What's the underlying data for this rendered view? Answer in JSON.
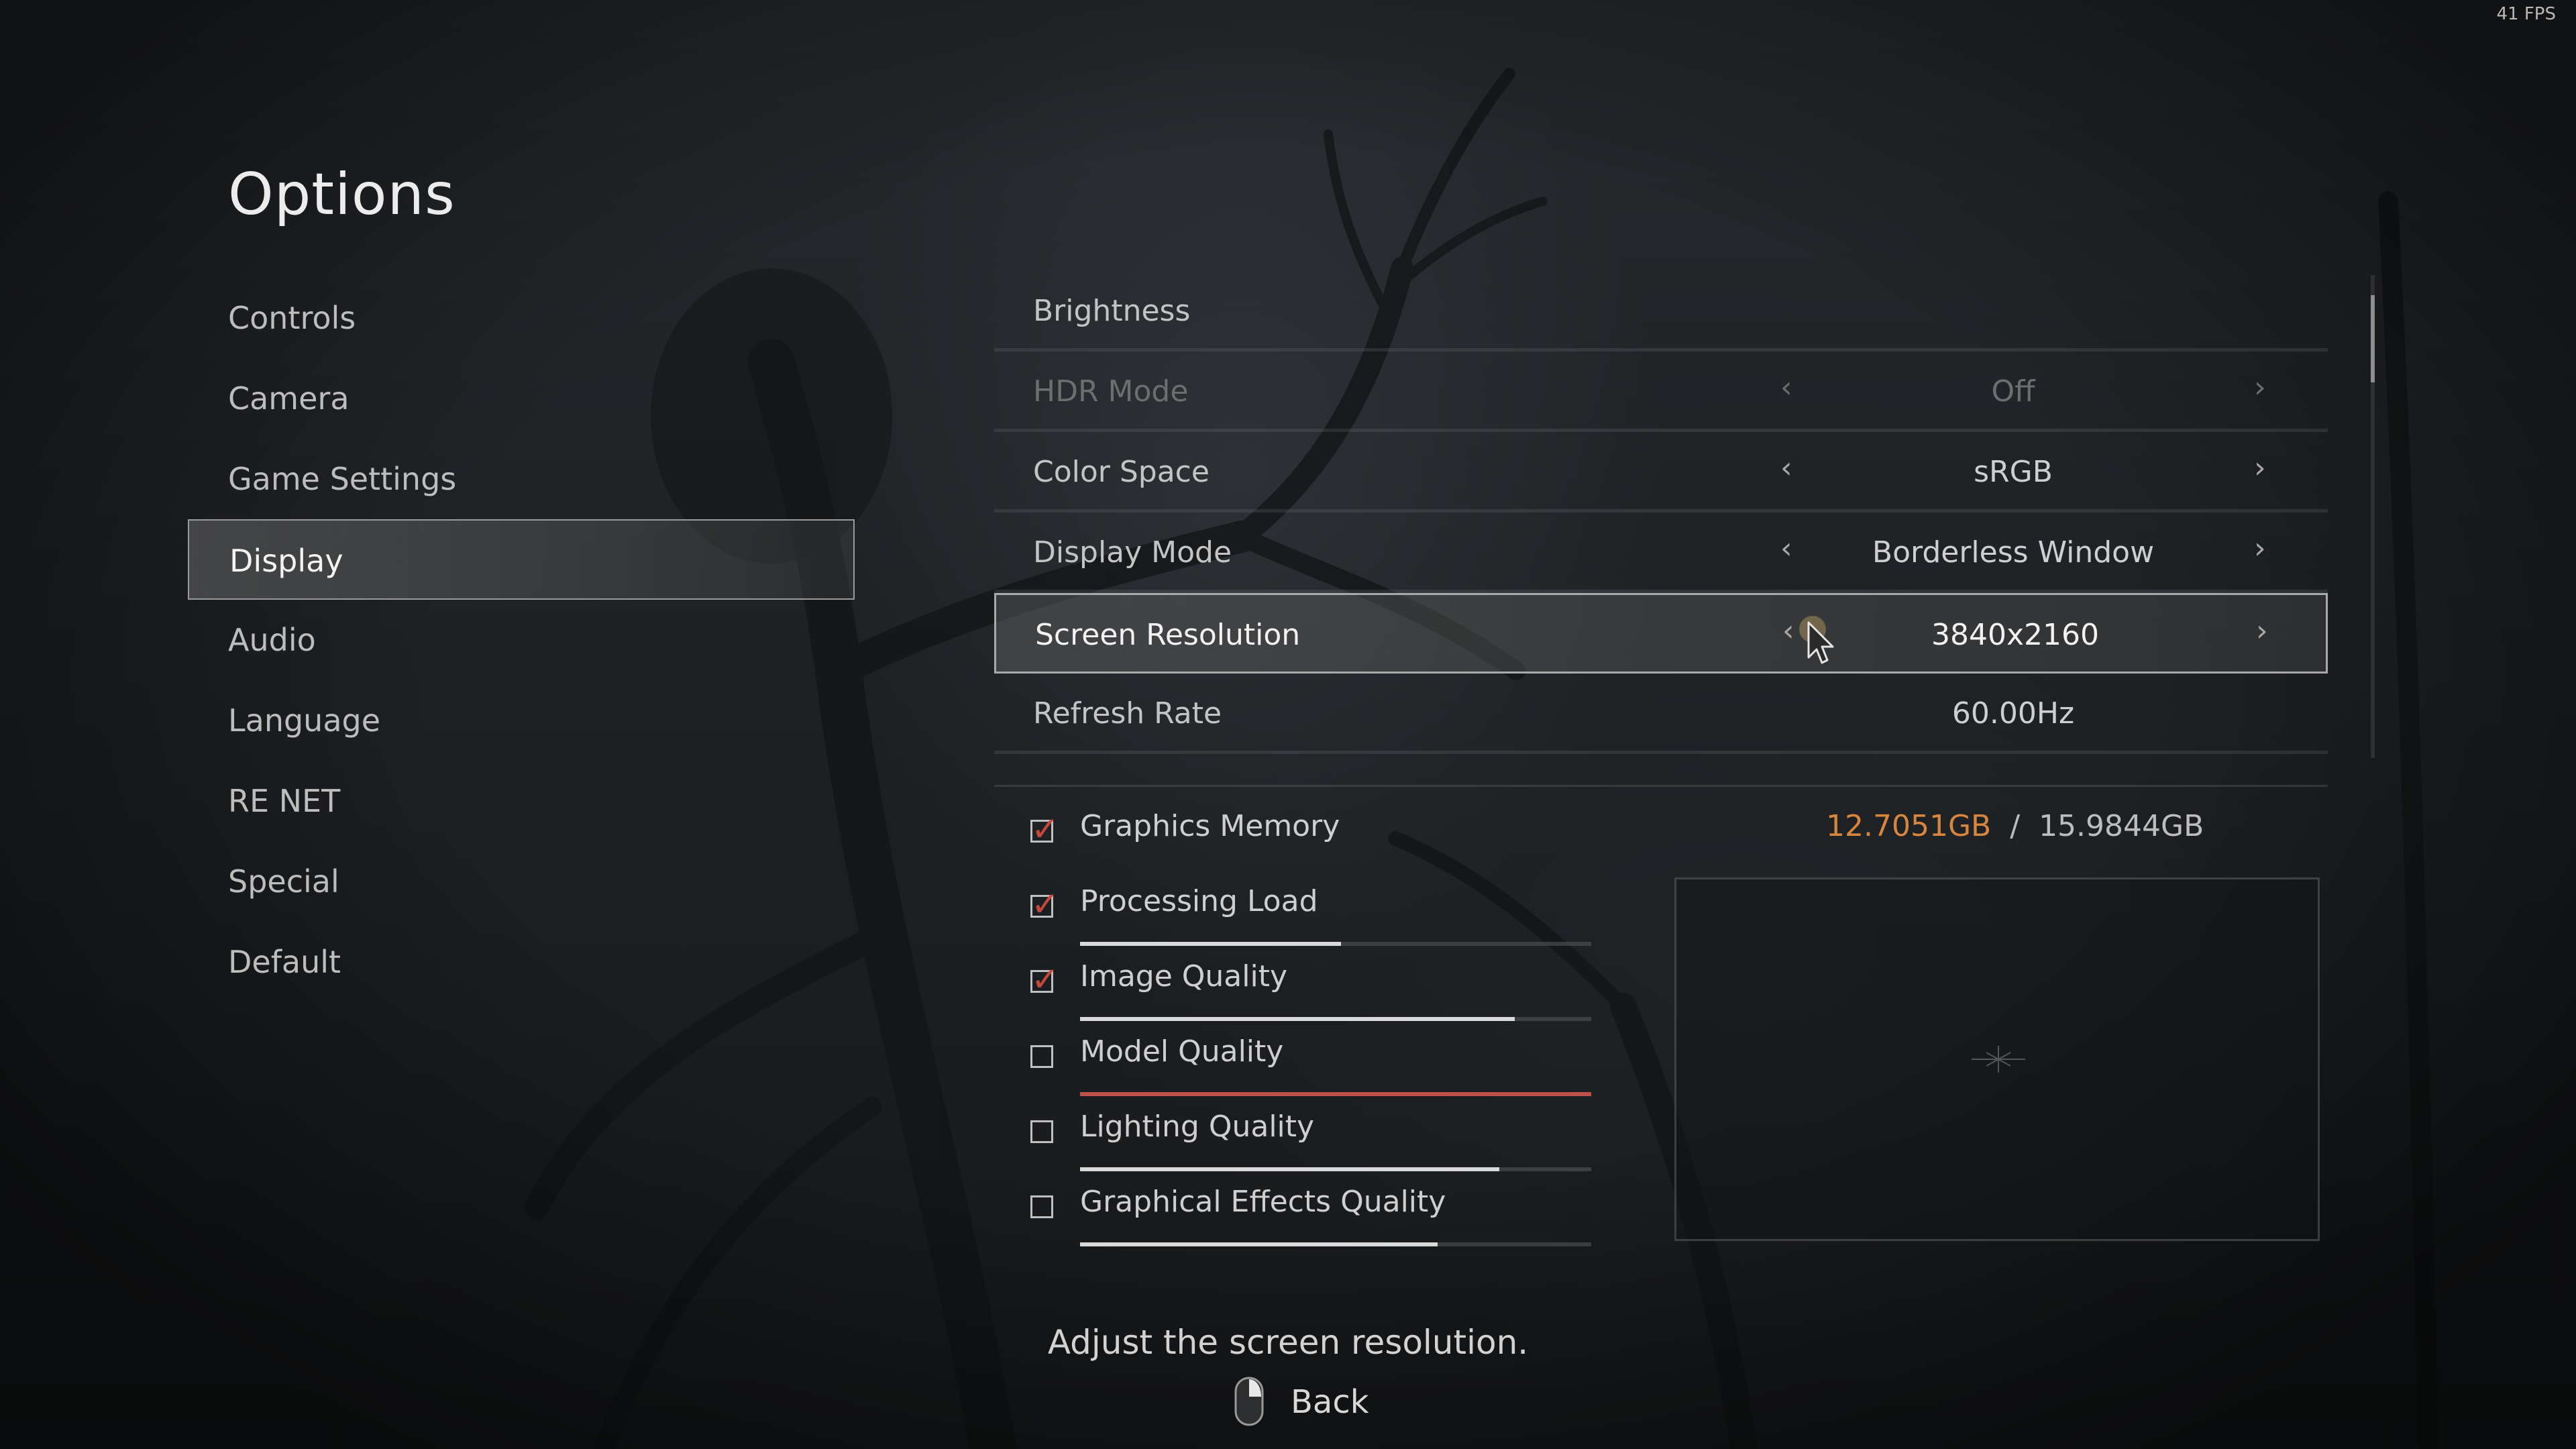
{
  "fps": "41 FPS",
  "title": "Options",
  "sidebar": {
    "items": [
      {
        "label": "Controls"
      },
      {
        "label": "Camera"
      },
      {
        "label": "Game Settings"
      },
      {
        "label": "Display",
        "active": true
      },
      {
        "label": "Audio"
      },
      {
        "label": "Language"
      },
      {
        "label": "RE NET"
      },
      {
        "label": "Special"
      },
      {
        "label": "Default"
      }
    ]
  },
  "display_settings": [
    {
      "label": "Brightness"
    },
    {
      "label": "HDR Mode",
      "value": "Off",
      "disabled": true
    },
    {
      "label": "Color Space",
      "value": "sRGB"
    },
    {
      "label": "Display Mode",
      "value": "Borderless Window"
    },
    {
      "label": "Screen Resolution",
      "value": "3840x2160",
      "selected": true
    },
    {
      "label": "Refresh Rate",
      "value": "60.00Hz"
    }
  ],
  "graphics": {
    "memory": {
      "label": "Graphics Memory",
      "used": "12.7051GB",
      "separator": "/",
      "total": "15.9844GB",
      "checked": true
    },
    "items": [
      {
        "label": "Processing Load",
        "checked": true,
        "level": 0.51
      },
      {
        "label": "Image Quality",
        "checked": true,
        "level": 0.85
      },
      {
        "label": "Model Quality",
        "checked": false,
        "level": 1.0,
        "color": "#c0504a"
      },
      {
        "label": "Lighting Quality",
        "checked": false,
        "level": 0.82
      },
      {
        "label": "Graphical Effects Quality",
        "checked": false,
        "level": 0.7
      }
    ]
  },
  "help_text": "Adjust the screen resolution.",
  "footer": {
    "back_label": "Back",
    "back_icon": "mouse-icon"
  },
  "colors": {
    "accent_memory": "#d7863c",
    "checkmark": "#c8473b"
  }
}
